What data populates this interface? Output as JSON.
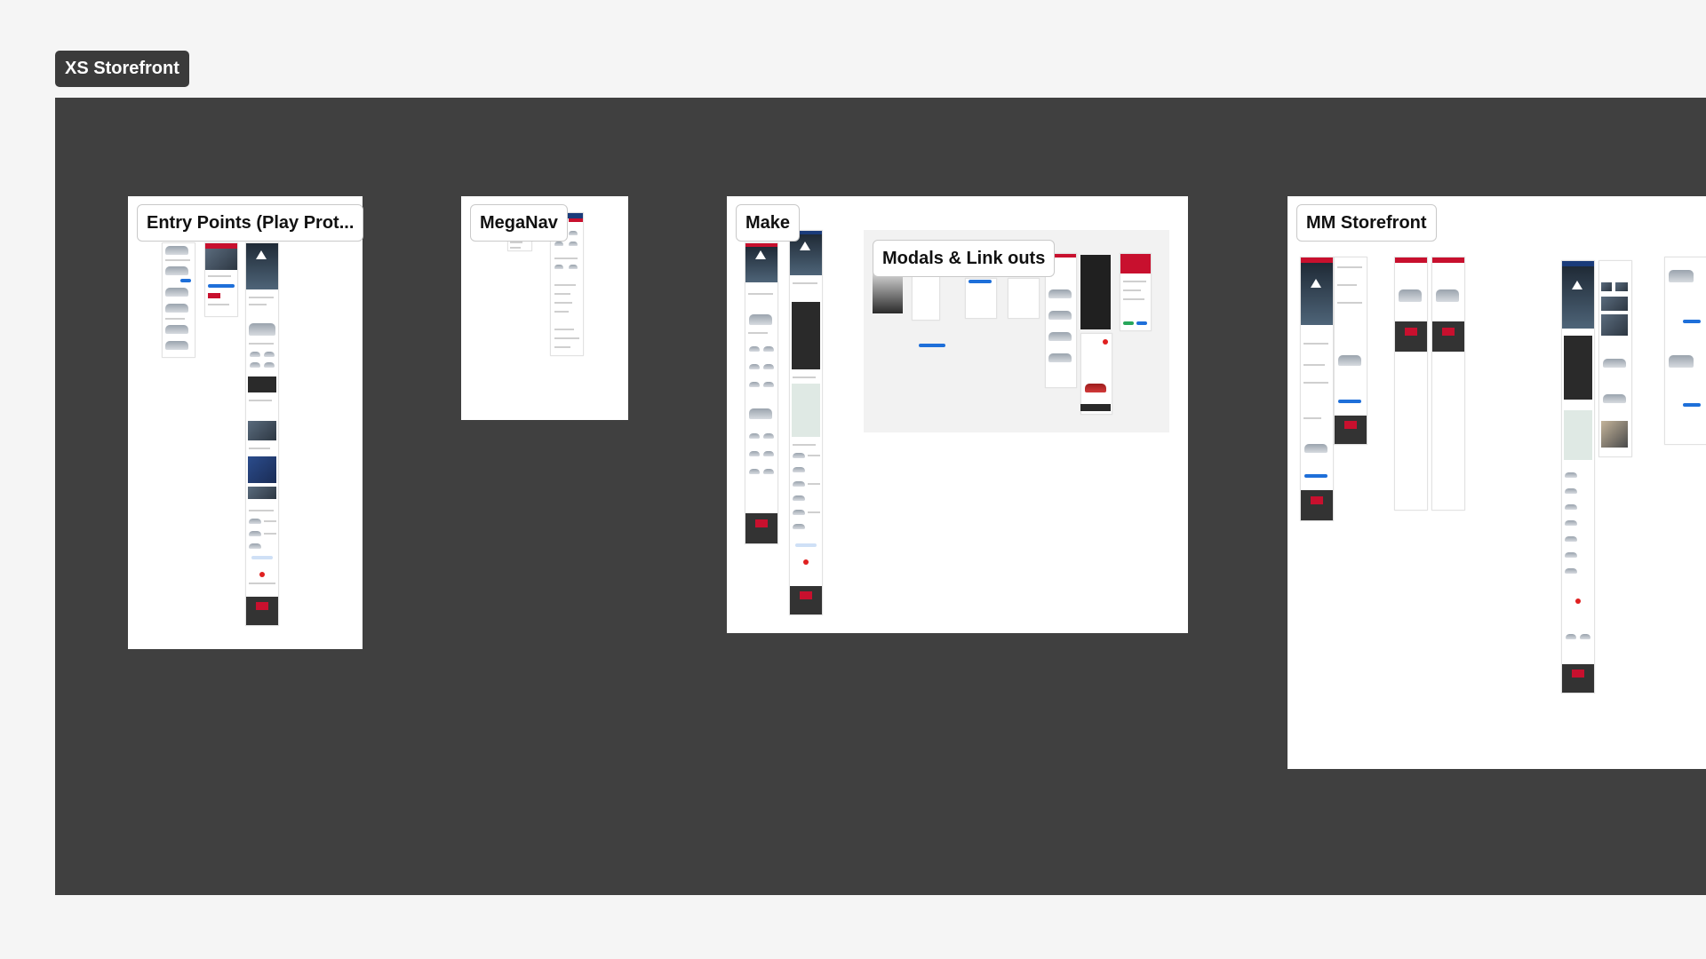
{
  "section": {
    "title": "XS Storefront"
  },
  "frames": {
    "entry_points": {
      "label": "Entry Points (Play Prot..."
    },
    "meganav": {
      "label": "MegaNav"
    },
    "make": {
      "label": "Make"
    },
    "modals": {
      "label": "Modals & Link outs"
    },
    "mm_storefront": {
      "label": "MM Storefront"
    }
  },
  "colors": {
    "canvas": "#f5f5f5",
    "board": "#404040",
    "brand_red": "#c8102e",
    "accent_blue": "#1e6fd9"
  }
}
